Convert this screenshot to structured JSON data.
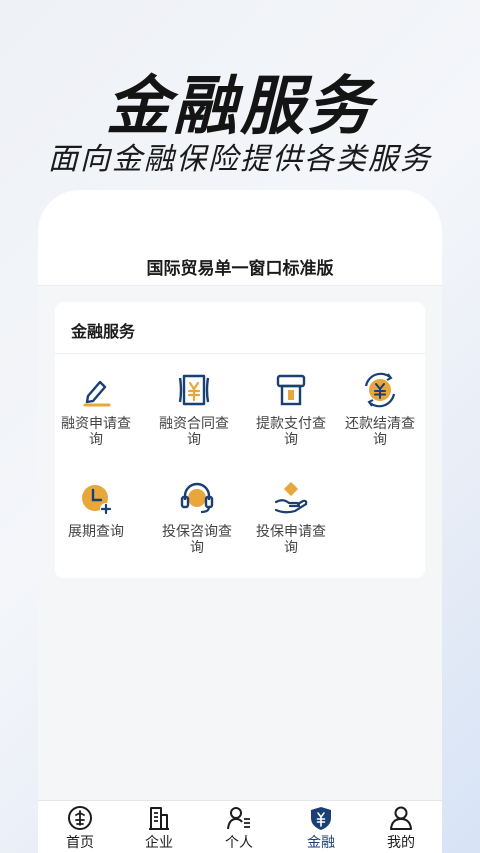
{
  "hero": {
    "title": "金融服务",
    "subtitle": "面向金融保险提供各类服务"
  },
  "screen": {
    "title": "国际贸易单一窗口标准版"
  },
  "card": {
    "title": "金融服务",
    "items": [
      {
        "label": "融资申请查询",
        "icon": "pen-icon"
      },
      {
        "label": "融资合同查询",
        "icon": "contract-yuan-icon"
      },
      {
        "label": "提款支付查询",
        "icon": "atm-withdraw-icon"
      },
      {
        "label": "还款结清查询",
        "icon": "yuan-refresh-icon"
      },
      {
        "label": "展期查询",
        "icon": "clock-plus-icon"
      },
      {
        "label": "投保咨询查询",
        "icon": "headset-icon"
      },
      {
        "label": "投保申请查询",
        "icon": "hand-coin-icon"
      }
    ]
  },
  "tabbar": {
    "items": [
      {
        "label": "首页",
        "icon": "home-icon",
        "active": false
      },
      {
        "label": "企业",
        "icon": "building-icon",
        "active": false
      },
      {
        "label": "个人",
        "icon": "person-list-icon",
        "active": false
      },
      {
        "label": "金融",
        "icon": "finance-shield-icon",
        "active": true
      },
      {
        "label": "我的",
        "icon": "user-icon",
        "active": false
      }
    ]
  },
  "colors": {
    "navy": "#1a3f72",
    "gold": "#e8a73a",
    "text": "#1c1c1c",
    "label": "#444444",
    "background": "#f5f6f8"
  }
}
